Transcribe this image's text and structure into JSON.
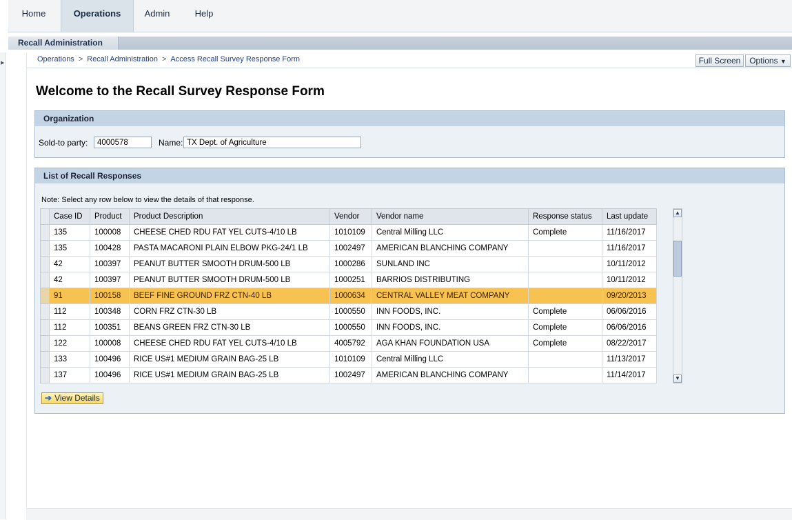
{
  "topnav": {
    "tabs": [
      {
        "label": "Home",
        "active": false
      },
      {
        "label": "Operations",
        "active": true
      },
      {
        "label": "Admin",
        "active": false
      },
      {
        "label": "Help",
        "active": false
      }
    ]
  },
  "subnav": {
    "active_label": "Recall Administration"
  },
  "breadcrumb": {
    "items": [
      "Operations",
      "Recall Administration",
      "Access Recall Survey Response Form"
    ],
    "separator": ">"
  },
  "header_buttons": {
    "full_screen": "Full Screen",
    "options": "Options",
    "options_icon": "caret-down-icon"
  },
  "page": {
    "title": "Welcome to the Recall Survey Response Form"
  },
  "organization": {
    "title": "Organization",
    "sold_to_label": "Sold-to party:",
    "sold_to_value": "4000578",
    "name_label": "Name:",
    "name_value": "TX Dept. of Agriculture"
  },
  "responses": {
    "title": "List of Recall Responses",
    "note": "Note: Select any row below to view the details of that response.",
    "columns": [
      "Case ID",
      "Product",
      "Product Description",
      "Vendor",
      "Vendor name",
      "Response status",
      "Last update"
    ],
    "rows": [
      [
        "135",
        "100008",
        "CHEESE CHED RDU FAT YEL CUTS-4/10 LB",
        "1010109",
        "Central Milling LLC",
        "Complete",
        "11/16/2017"
      ],
      [
        "135",
        "100428",
        "PASTA MACARONI PLAIN ELBOW PKG-24/1 LB",
        "1002497",
        "AMERICAN BLANCHING COMPANY",
        "",
        "11/16/2017"
      ],
      [
        "42",
        "100397",
        "PEANUT BUTTER SMOOTH DRUM-500 LB",
        "1000286",
        "SUNLAND INC",
        "",
        "10/11/2012"
      ],
      [
        "42",
        "100397",
        "PEANUT BUTTER SMOOTH DRUM-500 LB",
        "1000251",
        "BARRIOS DISTRIBUTING",
        "",
        "10/11/2012"
      ],
      [
        "91",
        "100158",
        "BEEF FINE GROUND FRZ CTN-40 LB",
        "1000634",
        "CENTRAL VALLEY MEAT COMPANY",
        "",
        "09/20/2013"
      ],
      [
        "112",
        "100348",
        "CORN FRZ CTN-30 LB",
        "1000550",
        "INN FOODS, INC.",
        "Complete",
        "06/06/2016"
      ],
      [
        "112",
        "100351",
        "BEANS GREEN FRZ CTN-30 LB",
        "1000550",
        "INN FOODS, INC.",
        "Complete",
        "06/06/2016"
      ],
      [
        "122",
        "100008",
        "CHEESE CHED RDU FAT YEL CUTS-4/10 LB",
        "4005792",
        "AGA KHAN FOUNDATION USA",
        "Complete",
        "08/22/2017"
      ],
      [
        "133",
        "100496",
        "RICE US#1 MEDIUM GRAIN BAG-25 LB",
        "1010109",
        "Central Milling LLC",
        "",
        "11/13/2017"
      ],
      [
        "137",
        "100496",
        "RICE US#1 MEDIUM GRAIN BAG-25 LB",
        "1002497",
        "AMERICAN BLANCHING COMPANY",
        "",
        "11/14/2017"
      ]
    ],
    "selected_row_index": 4,
    "view_details_label": "View Details",
    "view_details_icon": "right-arrow-icon"
  },
  "colors": {
    "highlight_row": "#f7c24f",
    "panel_header": "#c3d4e5",
    "panel_bg": "#ecf1f6"
  }
}
